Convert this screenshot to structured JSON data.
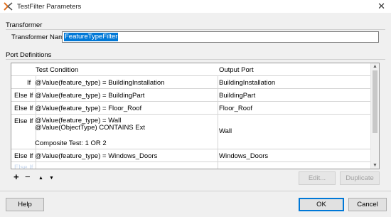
{
  "window": {
    "title": "TestFilter Parameters",
    "close_glyph": "✕",
    "icon": "fme-transformer-icon"
  },
  "transformer": {
    "section_label": "Transformer",
    "name_label": "Transformer Name:",
    "name_value": "FeatureTypeFilter"
  },
  "ports": {
    "section_label": "Port Definitions",
    "columns": {
      "test_condition": "Test Condition",
      "output_port": "Output Port"
    },
    "rows": [
      {
        "prefix": "If",
        "condition": "@Value(feature_type) = BuildingInstallation",
        "output": "BuildingInstallation"
      },
      {
        "prefix": "Else If",
        "condition": "@Value(feature_type) = BuildingPart",
        "output": "BuildingPart"
      },
      {
        "prefix": "Else If",
        "condition": "@Value(feature_type) = Floor_Roof",
        "output": "Floor_Roof"
      },
      {
        "prefix": "Else If",
        "condition_lines": [
          "@Value(feature_type) = Wall",
          "@Value(ObjectType) CONTAINS Ext",
          "Composite Test: 1 OR 2"
        ],
        "output": "Wall"
      },
      {
        "prefix": "Else If",
        "condition": "@Value(feature_type) = Windows_Doors",
        "output": "Windows_Doors"
      },
      {
        "prefix": "Else If",
        "condition": "",
        "output": ""
      }
    ]
  },
  "toolbar": {
    "add": "+",
    "remove": "−",
    "up": "▲",
    "down": "▼",
    "edit": "Edit...",
    "duplicate": "Duplicate"
  },
  "footer": {
    "help": "Help",
    "ok": "OK",
    "cancel": "Cancel"
  },
  "colors": {
    "selection": "#0078d7",
    "dialog_bg": "#f0f0f0"
  }
}
